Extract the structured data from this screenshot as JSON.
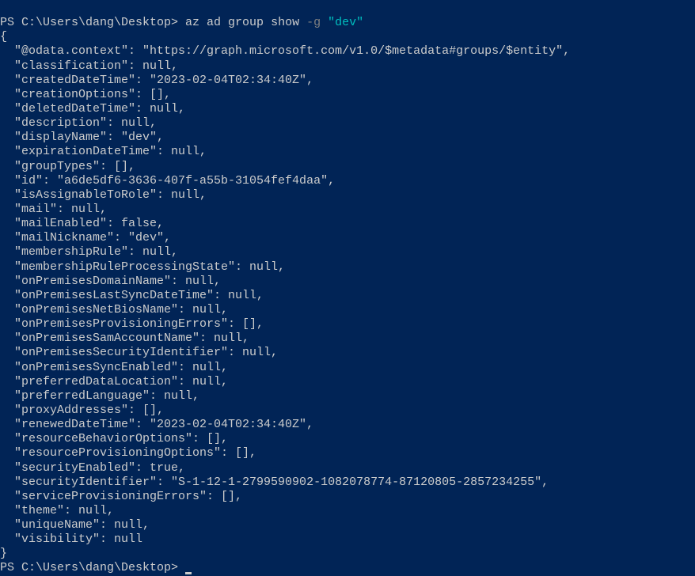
{
  "line1": {
    "prompt": "PS C:\\Users\\dang\\Desktop> ",
    "cmd": "az ad group show ",
    "flag": "-g ",
    "arg": "\"dev\""
  },
  "json": {
    "open": "{",
    "l01": "  \"@odata.context\": \"https://graph.microsoft.com/v1.0/$metadata#groups/$entity\",",
    "l02": "  \"classification\": null,",
    "l03": "  \"createdDateTime\": \"2023-02-04T02:34:40Z\",",
    "l04": "  \"creationOptions\": [],",
    "l05": "  \"deletedDateTime\": null,",
    "l06": "  \"description\": null,",
    "l07": "  \"displayName\": \"dev\",",
    "l08": "  \"expirationDateTime\": null,",
    "l09": "  \"groupTypes\": [],",
    "l10": "  \"id\": \"a6de5df6-3636-407f-a55b-31054fef4daa\",",
    "l11": "  \"isAssignableToRole\": null,",
    "l12": "  \"mail\": null,",
    "l13": "  \"mailEnabled\": false,",
    "l14": "  \"mailNickname\": \"dev\",",
    "l15": "  \"membershipRule\": null,",
    "l16": "  \"membershipRuleProcessingState\": null,",
    "l17": "  \"onPremisesDomainName\": null,",
    "l18": "  \"onPremisesLastSyncDateTime\": null,",
    "l19": "  \"onPremisesNetBiosName\": null,",
    "l20": "  \"onPremisesProvisioningErrors\": [],",
    "l21": "  \"onPremisesSamAccountName\": null,",
    "l22": "  \"onPremisesSecurityIdentifier\": null,",
    "l23": "  \"onPremisesSyncEnabled\": null,",
    "l24": "  \"preferredDataLocation\": null,",
    "l25": "  \"preferredLanguage\": null,",
    "l26": "  \"proxyAddresses\": [],",
    "l27": "  \"renewedDateTime\": \"2023-02-04T02:34:40Z\",",
    "l28": "  \"resourceBehaviorOptions\": [],",
    "l29": "  \"resourceProvisioningOptions\": [],",
    "l30": "  \"securityEnabled\": true,",
    "l31": "  \"securityIdentifier\": \"S-1-12-1-2799590902-1082078774-87120805-2857234255\",",
    "l32": "  \"serviceProvisioningErrors\": [],",
    "l33": "  \"theme\": null,",
    "l34": "  \"uniqueName\": null,",
    "l35": "  \"visibility\": null",
    "close": "}"
  },
  "line2": {
    "prompt": "PS C:\\Users\\dang\\Desktop> "
  }
}
